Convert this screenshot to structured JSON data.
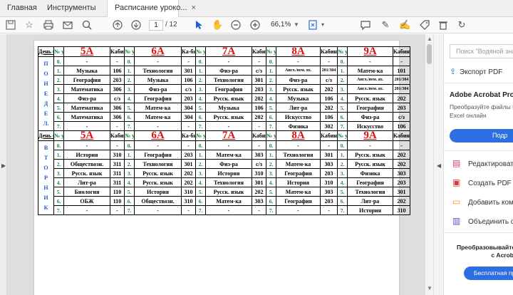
{
  "tabs": [
    {
      "label": "Главная"
    },
    {
      "label": "Инструменты"
    },
    {
      "label": "Расписание уроко...",
      "close": "×"
    }
  ],
  "toolbar": {
    "page_current": "1",
    "page_total": "/ 12",
    "zoom": "66,1%",
    "icons": [
      "save-icon",
      "bookmark-star-icon",
      "print-icon",
      "mail-icon",
      "search-zoom-icon",
      "page-up-icon",
      "page-down-icon",
      "select-arrow-icon",
      "hand-icon",
      "zoom-out-icon",
      "zoom-in-icon",
      "fit-page-icon",
      "comment-icon",
      "pen-icon",
      "sign-icon",
      "tag-icon",
      "delete-icon",
      "rotate-icon"
    ]
  },
  "right_pane": {
    "search_placeholder": "Поиск \"Водяной знак\"",
    "export_label": "Экспорт PDF",
    "ad_title": "Adobe Acrobat Pro DC",
    "ad_text_1": "Преобразуйте файлы PDF",
    "ad_text_2": "Excel онлайн",
    "ad_button": "Подр",
    "tools": [
      {
        "icon": "edit-pdf-icon",
        "label": "Редактировать"
      },
      {
        "icon": "create-pdf-icon",
        "label": "Создать PDF"
      },
      {
        "icon": "add-comment-icon",
        "label": "Добавить комм"
      },
      {
        "icon": "combine-files-icon",
        "label": "Объединить ф"
      }
    ],
    "promo_line_1": "Преобразовывайте и",
    "promo_line_2": "с Acrob",
    "promo_button": "Бесплатная пр"
  },
  "schedule": {
    "header": {
      "day": "День недели",
      "num": "№ урока",
      "room": "Кабинет",
      "room_alt": "Ка-бинет",
      "classes": [
        "5А",
        "6А",
        "7А",
        "8А",
        "9А"
      ]
    },
    "days": [
      {
        "name_letters": "П О Н Е Д Е Л.",
        "rows": [
          [
            "0.",
            "-",
            "-",
            "0.",
            "-",
            "-",
            "0.",
            "-",
            "-",
            "0.",
            "-",
            "-",
            "0.",
            "-",
            "-"
          ],
          [
            "1.",
            "Музыка",
            "106",
            "1.",
            "Технология",
            "301",
            "1.",
            "Физ-ра",
            "с/з",
            "1.",
            "Англ./нем. яз.",
            "201/304",
            "1.",
            "Матем-ка",
            "101"
          ],
          [
            "2.",
            "География",
            "203",
            "2.",
            "Музыка",
            "106",
            "2.",
            "Технология",
            "301",
            "2.",
            "Физ-ра",
            "с/з",
            "2.",
            "Англ./нем. яз.",
            "201/304"
          ],
          [
            "3.",
            "Математика",
            "306",
            "3.",
            "Физ-ра",
            "с/з",
            "3.",
            "География",
            "203",
            "3.",
            "Русск. язык",
            "202",
            "3.",
            "Англ./нем. яз.",
            "201/304"
          ],
          [
            "4.",
            "Физ-ра",
            "с/з",
            "4.",
            "География",
            "203",
            "4.",
            "Русск. язык",
            "202",
            "4.",
            "Музыка",
            "106",
            "4.",
            "Русск. язык",
            "202"
          ],
          [
            "5.",
            "Математика",
            "306",
            "5.",
            "Матем-ка",
            "304",
            "5.",
            "Музыка",
            "106",
            "5.",
            "Лит-ра",
            "202",
            "5.",
            "География",
            "203"
          ],
          [
            "6.",
            "Математика",
            "306",
            "6.",
            "Матем-ка",
            "304",
            "6.",
            "Русск. язык",
            "202",
            "6.",
            "Искусство",
            "106",
            "6.",
            "Физ-ра",
            "с/з"
          ],
          [
            "7.",
            "-",
            "-",
            "7.",
            "-",
            "-",
            "7.",
            "-",
            "-",
            "7.",
            "Физика",
            "302",
            "7.",
            "Искусство",
            "106"
          ]
        ]
      },
      {
        "name_letters": "В Т О Р Н И К",
        "rows": [
          [
            "0.",
            "-",
            "-",
            "0.",
            "-",
            "-",
            "0.",
            "-",
            "-",
            "0.",
            "-",
            "-",
            "0.",
            "-",
            "-"
          ],
          [
            "1.",
            "История",
            "310",
            "1.",
            "География",
            "203",
            "1.",
            "Матем-ка",
            "303",
            "1.",
            "Технология",
            "301",
            "1.",
            "Русск. язык",
            "202"
          ],
          [
            "2.",
            "Обществозн.",
            "311",
            "2.",
            "Технология",
            "301",
            "2.",
            "Физ-ра",
            "с/з",
            "2.",
            "Матем-ка",
            "303",
            "2.",
            "Русск. язык",
            "202"
          ],
          [
            "3.",
            "Русск. язык",
            "311",
            "3.",
            "Русск. язык",
            "202",
            "3.",
            "История",
            "310",
            "3.",
            "География",
            "203",
            "3.",
            "Физика",
            "303"
          ],
          [
            "4.",
            "Лит-ра",
            "311",
            "4.",
            "Русск. язык",
            "202",
            "4.",
            "Технология",
            "301",
            "4.",
            "История",
            "310",
            "4.",
            "География",
            "203"
          ],
          [
            "5.",
            "Биология",
            "110",
            "5.",
            "История",
            "310",
            "5.",
            "Русск. язык",
            "202",
            "5.",
            "Матем-ка",
            "303",
            "5.",
            "Технология",
            "301"
          ],
          [
            "6.",
            "ОБЖ",
            "110",
            "6.",
            "Обществозн.",
            "310",
            "6.",
            "Матем-ка",
            "303",
            "6.",
            "География",
            "203",
            "6.",
            "Лит-ра",
            "202"
          ],
          [
            "7.",
            "-",
            "-",
            "7.",
            "-",
            "-",
            "7.",
            "-",
            "-",
            "7.",
            "-",
            "-",
            "7.",
            "История",
            "310"
          ]
        ]
      }
    ]
  }
}
